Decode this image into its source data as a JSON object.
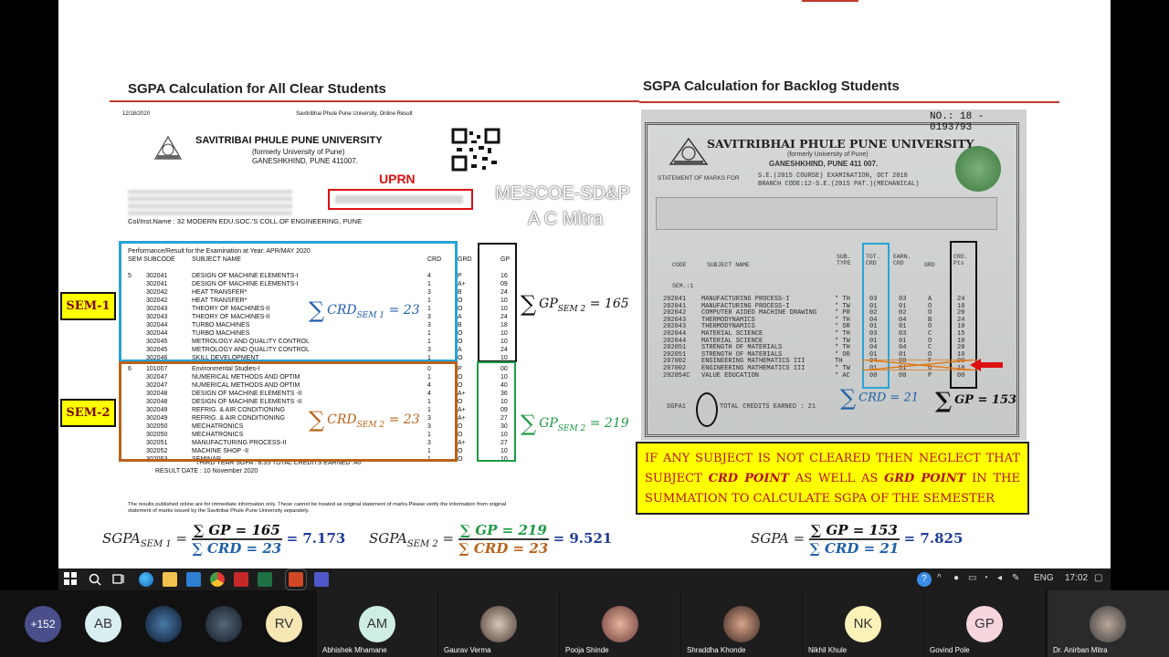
{
  "slide": {
    "left_title": "SGPA Calculation for All Clear Students",
    "right_title": "SGPA Calculation for Backlog Students",
    "watermark": [
      "MESCOE-SD&P",
      "A C Mitra"
    ]
  },
  "left_doc": {
    "date": "12/18/2020",
    "site": "Savitribhai Phule Pune University, Online Result",
    "univ_name": "SAVITRIBAI PHULE PUNE UNIVERSITY",
    "univ_former": "(formerly University of Pune)",
    "univ_addr": "GANESHKHIND, PUNE 411007.",
    "uprn_label": "UPRN",
    "college": "Col/Inst.Name : 32  MODERN EDU.SOC.'S COLL.OF ENGINEERING, PUNE",
    "perf_header": "Performance/Result for the Examination at Year: APR/MAY 2020",
    "col_headers": [
      "SEM SUBCODE",
      "SUBJECT NAME",
      "CRD",
      "GRD",
      "GP"
    ],
    "sem1_rows": [
      [
        "5",
        "302041",
        "DESIGN OF MACHINE ELEMENTS-I",
        "4",
        "P",
        "16"
      ],
      [
        "",
        "302041",
        "DESIGN OF MACHINE ELEMENTS-I",
        "1",
        "A+",
        "09"
      ],
      [
        "",
        "302042",
        "HEAT TRANSFER*",
        "3",
        "B",
        "24"
      ],
      [
        "",
        "302042",
        "HEAT TRANSFER*",
        "1",
        "O",
        "10"
      ],
      [
        "",
        "302043",
        "THEORY OF MACHINES-II",
        "1",
        "O",
        "10"
      ],
      [
        "",
        "302043",
        "THEORY OF MACHINES-II",
        "3",
        "A",
        "24"
      ],
      [
        "",
        "302044",
        "TURBO MACHINES",
        "3",
        "B",
        "18"
      ],
      [
        "",
        "302044",
        "TURBO MACHINES",
        "1",
        "O",
        "10"
      ],
      [
        "",
        "302045",
        "METROLOGY AND QUALITY CONTROL",
        "1",
        "O",
        "10"
      ],
      [
        "",
        "302045",
        "METROLOGY AND QUALITY CONTROL",
        "3",
        "A",
        "24"
      ],
      [
        "",
        "302046",
        "SKILL DEVELOPMENT",
        "1",
        "O",
        "10"
      ]
    ],
    "sem2_rows": [
      [
        "6",
        "101007",
        "Environmental Studies-I",
        "0",
        "P",
        "00"
      ],
      [
        "",
        "302047",
        "NUMERICAL METHODS AND OPTIM",
        "1",
        "O",
        "10"
      ],
      [
        "",
        "302047",
        "NUMERICAL METHODS AND OPTIM",
        "4",
        "O",
        "40"
      ],
      [
        "",
        "302048",
        "DESIGN OF MACHINE ELEMENTS -II",
        "4",
        "A+",
        "36"
      ],
      [
        "",
        "302048",
        "DESIGN OF MACHINE ELEMENTS -II",
        "1",
        "O",
        "10"
      ],
      [
        "",
        "302049",
        "REFRIG. & AIR CONDITIONING",
        "1",
        "A+",
        "09"
      ],
      [
        "",
        "302049",
        "REFRIG. & AIR CONDITIONING",
        "3",
        "A+",
        "27"
      ],
      [
        "",
        "302050",
        "MECHATRONICS",
        "3",
        "O",
        "30"
      ],
      [
        "",
        "302050",
        "MECHATRONICS",
        "1",
        "O",
        "10"
      ],
      [
        "",
        "302051",
        "MANUFACTURING PROCESS-II",
        "3",
        "A+",
        "27"
      ],
      [
        "",
        "302052",
        "MACHINE SHOP -II",
        "1",
        "O",
        "10"
      ],
      [
        "",
        "302053",
        "SEMINAR",
        "1",
        "O",
        "10"
      ]
    ],
    "sgpa_line": "THIRD YEAR SGPA : 8.35 TOTAL CREDITS EARNED :46",
    "result_date": "RESULT DATE : 10 November 2020",
    "disclaimer": "The results published online are for immediate information only. These cannot be treated as original statement of marks.Please verify the information from original statement of marks issued by the Savitribai Phule Pune University separately.",
    "sem1_tag": "SEM-1",
    "sem2_tag": "SEM-2",
    "crd_sem1": "CRD",
    "crd_sem1_sub": "SEM 1",
    "crd_sem1_val": "= 23",
    "crd_sem2": "CRD",
    "crd_sem2_sub": "SEM 2",
    "crd_sem2_val": "= 23",
    "gp_sem1": "GP",
    "gp_sem1_sub": "SEM 2",
    "gp_sem1_val": "= 165",
    "gp_sem2": "GP",
    "gp_sem2_sub": "SEM 2",
    "gp_sem2_val": "= 219"
  },
  "right_doc": {
    "cert_no": "NO.: 18 - 0193793",
    "univ_name": "SAVITRIBHAI PHULE PUNE UNIVERSITY",
    "univ_former": "(formerly University of Pune)",
    "univ_addr": "GANESHKHIND, PUNE 411 007.",
    "stmt_label": "STATEMENT OF MARKS FOR",
    "exam": "S.E.(2015 COURSE) EXAMINATION, OCT 2018",
    "branch": "BRANCH CODE:12-S.E.(2015 PAT.)(MECHANICAL)",
    "col_headers": [
      "CODE",
      "SUBJECT NAME",
      "SUB. TYPE",
      "TOT. CRD",
      "EARN. CRD",
      "GRD",
      "CRD. Pts"
    ],
    "sem_label": "SEM.:1",
    "rows": [
      [
        "202041",
        "MANUFACTURING PROCESS-I",
        "* TH",
        "03",
        "03",
        "A",
        "24"
      ],
      [
        "202041",
        "MANUFACTURING PROCESS-I",
        "* TW",
        "01",
        "01",
        "O",
        "10"
      ],
      [
        "202042",
        "COMPUTER AIDED MACHINE DRAWING",
        "* PR",
        "02",
        "02",
        "O",
        "20"
      ],
      [
        "202043",
        "THERMODYNAMICS",
        "* TH",
        "04",
        "04",
        "B",
        "24"
      ],
      [
        "202043",
        "THERMODYNAMICS",
        "* OR",
        "01",
        "01",
        "O",
        "10"
      ],
      [
        "202044",
        "MATERIAL SCIENCE",
        "* TH",
        "03",
        "03",
        "C",
        "15"
      ],
      [
        "202044",
        "MATERIAL SCIENCE",
        "* TW",
        "01",
        "01",
        "O",
        "10"
      ],
      [
        "202051",
        "STRENGTH OF MATERIALS",
        "* TH",
        "04",
        "04",
        "C",
        "20"
      ],
      [
        "202051",
        "STRENGTH OF MATERIALS",
        "* OR",
        "01",
        "01",
        "O",
        "10"
      ],
      [
        "207002",
        "ENGINEERING MATHEMATICS III",
        "TH",
        "04",
        "00",
        "F",
        "00"
      ],
      [
        "207002",
        "ENGINEERING MATHEMATICS III",
        "* TW",
        "01",
        "01",
        "O",
        "10"
      ],
      [
        "202054C",
        "VALUE EDUCATION",
        "* AC",
        "00",
        "00",
        "P",
        "00"
      ]
    ],
    "sgpa_label": "SGPA1",
    "credits_earned": "TOTAL CREDITS EARNED : 21",
    "crd_sum": "CRD = 21",
    "gp_sum": "GP = 153"
  },
  "note": "IF ANY SUBJECT IS NOT CLEARED THEN NEGLECT THAT SUBJECT CRD POINT AS WELL AS GRD POINT IN THE SUMMATION TO CALCULATE SGPA OF THE SEMESTER",
  "note_parts": {
    "a": "IF ANY SUBJECT IS NOT CLEARED THEN NEGLECT THAT SUBJECT ",
    "b": "CRD POINT",
    "c": " AS WELL AS ",
    "d": "GRD POINT",
    "e": " IN THE SUMMATION TO CALCULATE SGPA OF THE SEMESTER"
  },
  "formulas": {
    "f1_lhs": "SGPA",
    "f1_sub": "SEM 1",
    "f1_num": "∑ GP = 165",
    "f1_den": "∑ CRD = 23",
    "f1_res": "= 7.173",
    "f2_lhs": "SGPA",
    "f2_sub": "SEM 2",
    "f2_num": "∑ GP = 219",
    "f2_den": "∑ CRD = 23",
    "f2_res": "= 9.521",
    "f3_lhs": "SGPA",
    "f3_num": "∑ GP = 153",
    "f3_den": "∑ CRD = 21",
    "f3_res": "= 7.825"
  },
  "taskbar": {
    "lang": "ENG",
    "time": "17:02"
  },
  "participants": {
    "more_count": "+152",
    "tiles": [
      {
        "initials": "AB",
        "name": ""
      },
      {
        "initials": "",
        "name": ""
      },
      {
        "initials": "",
        "name": ""
      },
      {
        "initials": "RV",
        "name": ""
      },
      {
        "initials": "AM",
        "name": "Abhishek Mhamane"
      },
      {
        "initials": "",
        "name": "Gaurav Verma"
      },
      {
        "initials": "",
        "name": "Pooja Shinde"
      },
      {
        "initials": "",
        "name": "Shraddha Khonde"
      },
      {
        "initials": "NK",
        "name": "Nikhil Khule"
      },
      {
        "initials": "GP",
        "name": "Govind Pole"
      },
      {
        "initials": "",
        "name": "Dr. Anirban Mitra"
      }
    ]
  },
  "colors": {
    "sem1_blue": "#29a3d6",
    "sem2_brown": "#b8631a",
    "green": "#1f9a45",
    "result_blue": "#1f3c99",
    "note_bg": "#ffff00",
    "note_text": "#b5121b"
  }
}
